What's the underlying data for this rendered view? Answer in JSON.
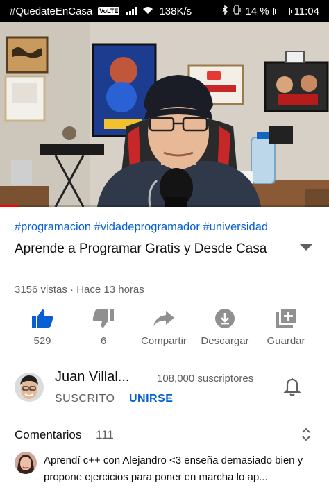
{
  "status_bar": {
    "carrier_text": "#QuedateEnCasa",
    "volte_badge": "VoLTE",
    "speed": "138K/s",
    "battery": "14 %",
    "battery_level": 0.14,
    "time": "11:04"
  },
  "video": {
    "progress_fraction": 0.06
  },
  "hashtags": "#programacion #vidadeprogramador #universidad",
  "title": "Aprende a Programar Gratis y Desde Casa",
  "meta": "3156 vistas · Hace 13 horas",
  "actions": [
    {
      "label": "529",
      "icon": "thumbs-up-icon"
    },
    {
      "label": "6",
      "icon": "thumbs-down-icon"
    },
    {
      "label": "Compartir",
      "icon": "share-icon"
    },
    {
      "label": "Descargar",
      "icon": "download-icon"
    },
    {
      "label": "Guardar",
      "icon": "add-to-playlist-icon"
    }
  ],
  "channel": {
    "name": "Juan Villal...",
    "subscribers": "108,000 suscriptores",
    "subscribed_label": "SUSCRITO",
    "join_label": "UNIRSE"
  },
  "comments": {
    "title": "Comentarios",
    "count": "111",
    "first_comment": "Aprendí c++ con Alejandro <3   enseña demasiado bien y propone ejercicios para poner en marcha lo ap..."
  },
  "colors": {
    "link_blue": "#065fd4",
    "like_blue": "#065fd4",
    "icon_gray": "#909090",
    "progress_red": "#ff0000"
  }
}
